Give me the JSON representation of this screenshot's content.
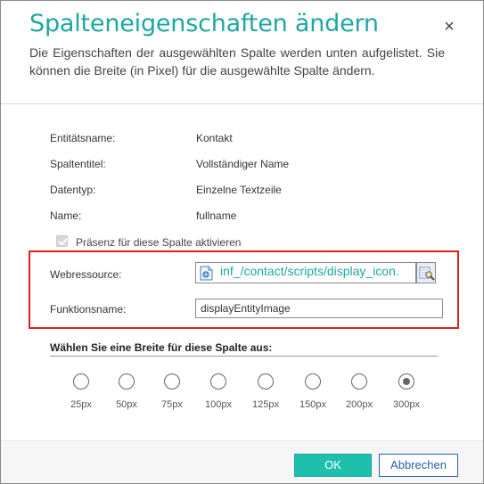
{
  "dialog": {
    "title": "Spalteneigenschaften ändern",
    "close_symbol": "×",
    "description": "Die Eigenschaften der ausgewählten Spalte werden unten aufgelistet. Sie können die Breite (in Pixel) für die ausgewählte Spalte ändern."
  },
  "properties": [
    {
      "label": "Entitätsname:",
      "value": "Kontakt"
    },
    {
      "label": "Spaltentitel:",
      "value": "Vollständiger Name"
    },
    {
      "label": "Datentyp:",
      "value": "Einzelne Textzeile"
    },
    {
      "label": "Name:",
      "value": "fullname"
    }
  ],
  "presence_checkbox": {
    "label": "Präsenz für diese Spalte aktivieren",
    "checked": true,
    "disabled": true
  },
  "webresource": {
    "label": "Webressource:",
    "value": "inf_/contact/scripts/display_icon.",
    "icon": "webresource-file-icon",
    "lookup_icon": "lookup-search-icon"
  },
  "function_name": {
    "label": "Funktionsname:",
    "value": "displayEntityImage"
  },
  "width_section": {
    "heading": "Wählen Sie eine Breite für diese Spalte aus:",
    "options": [
      "25px",
      "50px",
      "75px",
      "100px",
      "125px",
      "150px",
      "200px",
      "300px"
    ],
    "selected": "300px"
  },
  "buttons": {
    "ok": "OK",
    "cancel": "Abbrechen"
  },
  "colors": {
    "title": "#1fa7a2",
    "highlight_border": "#e02020",
    "ok_button": "#1ec0ad",
    "cancel_border": "#2a5ea8"
  }
}
